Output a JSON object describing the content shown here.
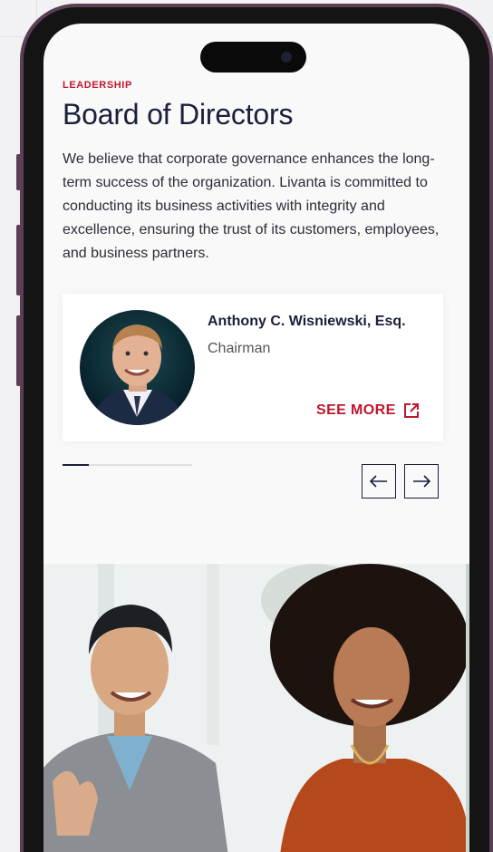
{
  "section": {
    "eyebrow": "LEADERSHIP",
    "title": "Board of Directors",
    "description": "We believe that corporate governance enhances the long-term success of the organization. Livanta is committed to conducting its business activities with integrity and excellence, ensuring the trust of its customers, employees, and business partners."
  },
  "carousel": {
    "cards": [
      {
        "name": "Anthony C. Wisniewski, Esq.",
        "role": "Chairman",
        "link_label": "SEE MORE"
      }
    ],
    "progress": 0.2,
    "prev_icon": "arrow-left-icon",
    "next_icon": "arrow-right-icon"
  },
  "colors": {
    "accent": "#c0162e",
    "navy": "#1a1f3a",
    "frame": "#5d3f55"
  }
}
